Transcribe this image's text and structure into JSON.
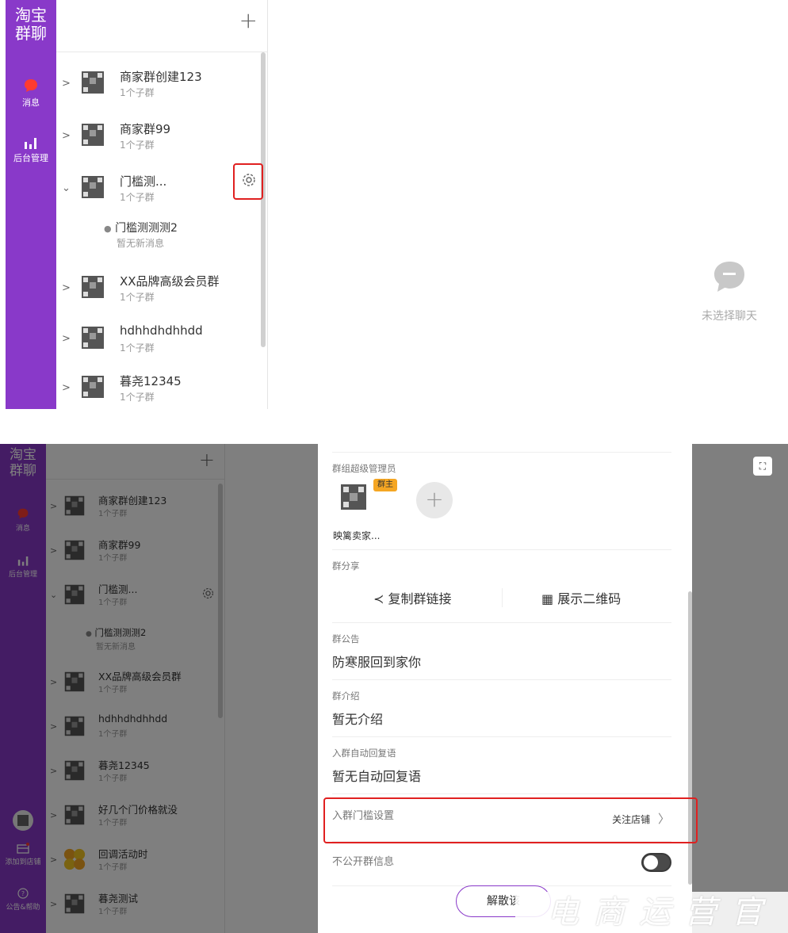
{
  "app": {
    "logo_line1": "淘宝",
    "logo_line2": "群聊"
  },
  "nav": {
    "messages": "消息",
    "admin": "后台管理",
    "add_store": "添加到店铺",
    "announcements": "公告&帮助"
  },
  "list": {
    "add_label": "+",
    "groups": [
      {
        "name": "商家群创建123",
        "sub": "1个子群"
      },
      {
        "name": "商家群99",
        "sub": "1个子群"
      },
      {
        "name": "门槛测...",
        "sub": "1个子群"
      },
      {
        "name": "XX品牌高级会员群",
        "sub": "1个子群"
      },
      {
        "name": "hdhhdhdhhdd",
        "sub": "1个子群"
      },
      {
        "name": "暮尧12345",
        "sub": "1个子群"
      },
      {
        "name": "好几个门价格就没",
        "sub": "1个子群"
      },
      {
        "name": "回调活动时",
        "sub": "1个子群"
      },
      {
        "name": "暮尧测试",
        "sub": "1个子群"
      }
    ],
    "subgroup": {
      "name": "门槛测测测2",
      "sub": "暂无新消息"
    }
  },
  "empty_state": {
    "text": "未选择聊天"
  },
  "panel": {
    "admin_label": "群组超级管理员",
    "owner_badge": "群主",
    "admin_add": "+",
    "admin_name": "映篱卖家...",
    "share_label": "群分享",
    "copy_link": "复制群链接",
    "show_qr": "展示二维码",
    "notice_label": "群公告",
    "notice_value": "防寒服回到家你",
    "intro_label": "群介绍",
    "intro_value": "暂无介绍",
    "autoreply_label": "入群自动回复语",
    "autoreply_value": "暂无自动回复语",
    "threshold_label": "入群门槛设置",
    "threshold_value": "关注店铺",
    "private_label": "不公开群信息",
    "disband_label": "解散该"
  },
  "watermark": "电商运营官",
  "colors": {
    "sidebar": "#8939c9",
    "highlight": "#e02020",
    "badge": "#f5a623"
  }
}
